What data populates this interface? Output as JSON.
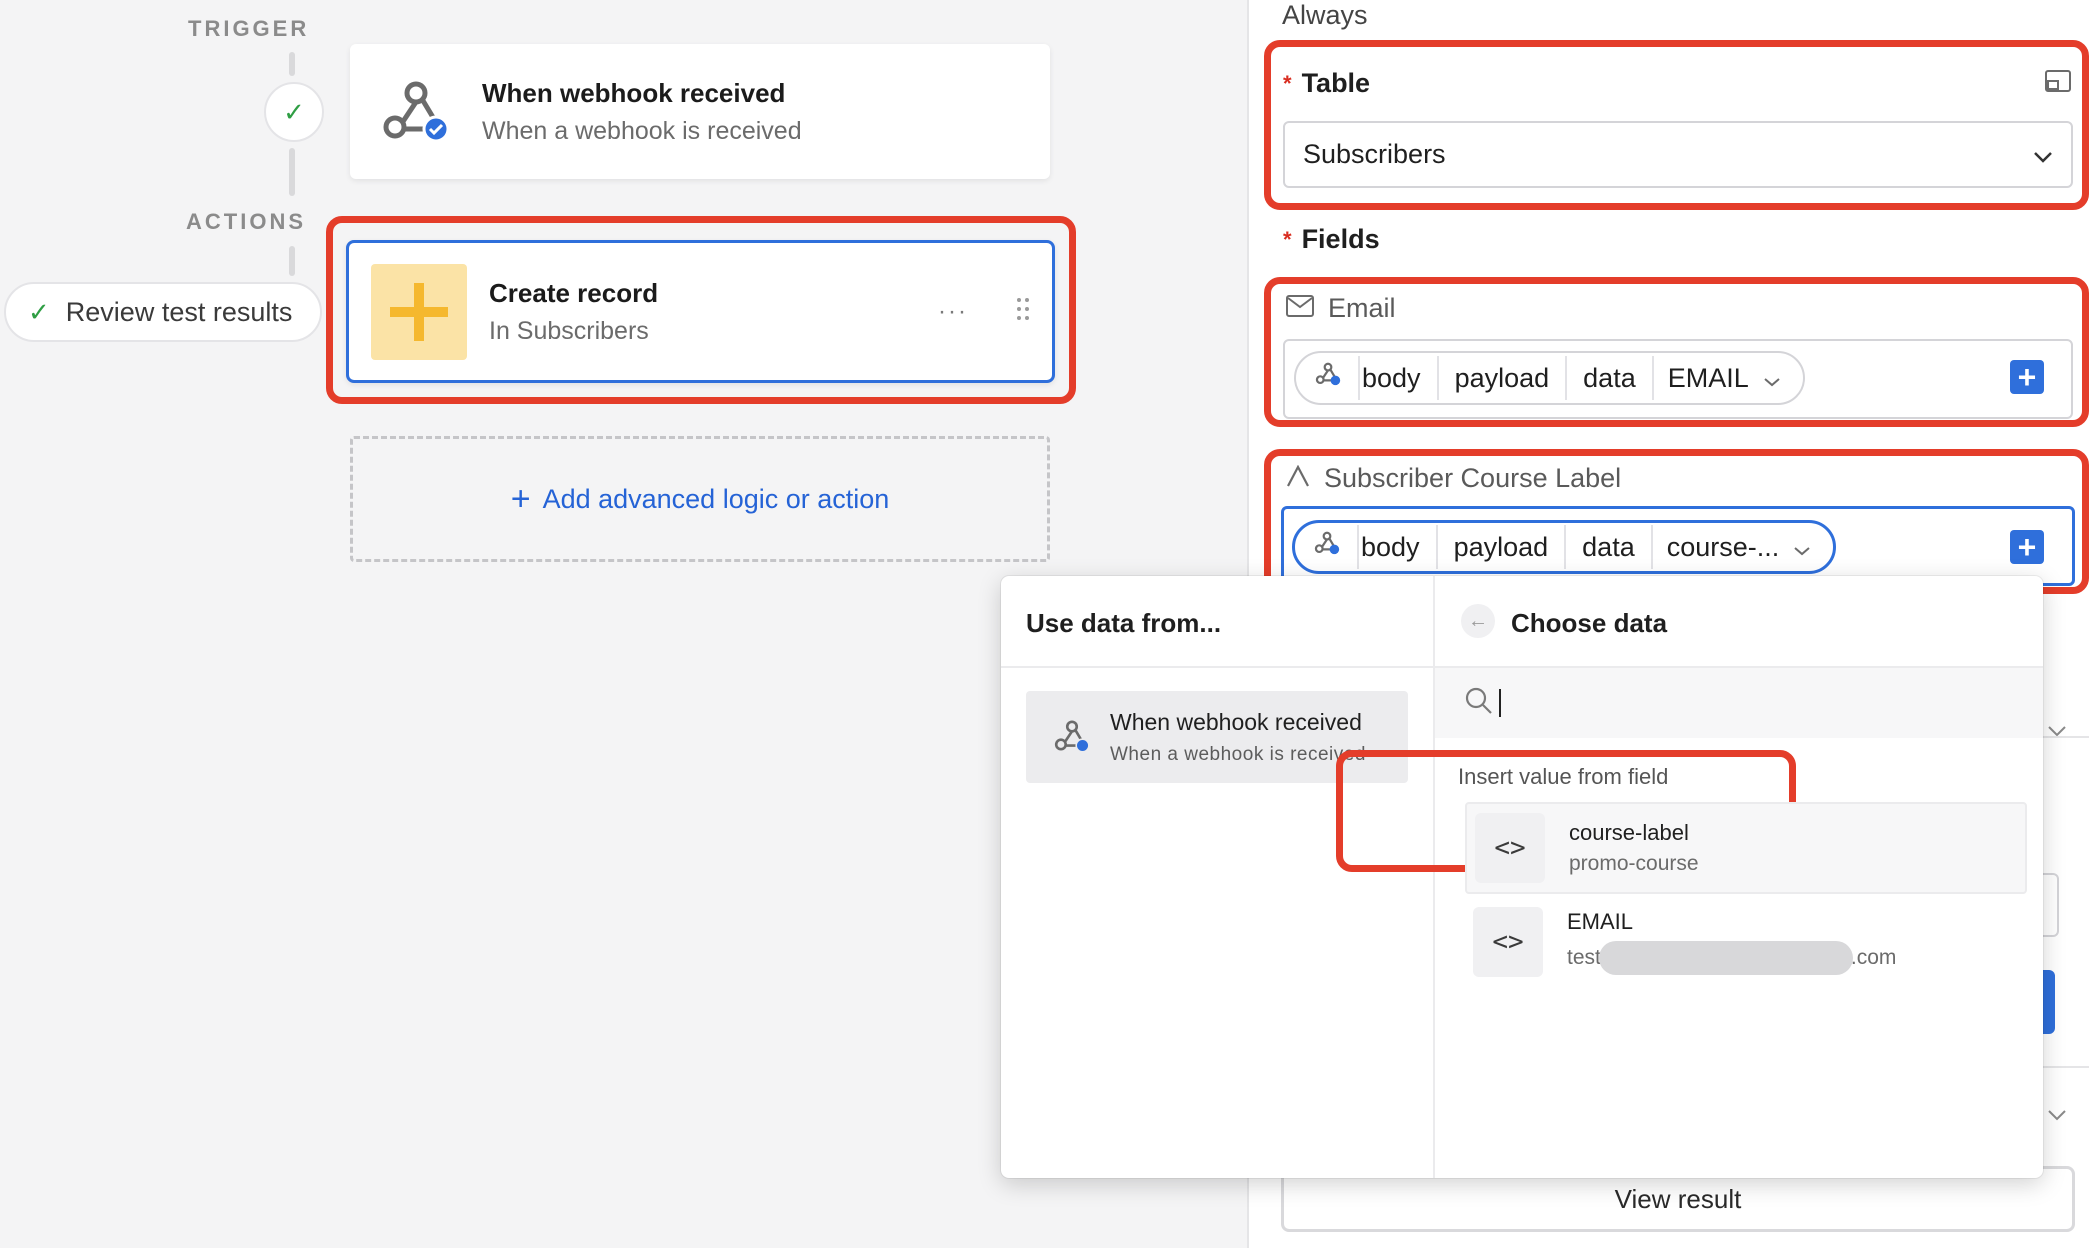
{
  "canvas": {
    "trigger_label": "TRIGGER",
    "actions_label": "ACTIONS",
    "review_label": "Review test results",
    "trigger_card": {
      "title": "When webhook received",
      "subtitle": "When a webhook is received"
    },
    "action_card": {
      "title": "Create record",
      "subtitle": "In Subscribers"
    },
    "add_action_label": "Add advanced logic or action"
  },
  "panel": {
    "condition_text": "Always",
    "table_label": "Table",
    "table_value": "Subscribers",
    "fields_label": "Fields",
    "email_field": {
      "label": "Email",
      "tokens": [
        "body",
        "payload",
        "data",
        "EMAIL"
      ]
    },
    "course_field": {
      "label": "Subscriber Course Label",
      "tokens": [
        "body",
        "payload",
        "data",
        "course-..."
      ]
    },
    "view_result_label": "View result"
  },
  "popup": {
    "left_heading": "Use data from...",
    "source": {
      "title": "When webhook received",
      "subtitle": "When a webhook is received"
    },
    "right_heading": "Choose data",
    "search_placeholder": "",
    "insert_label": "Insert value from field",
    "items": [
      {
        "title": "course-label",
        "value": "promo-course"
      },
      {
        "title": "EMAIL",
        "value_prefix": "test",
        "value_suffix": ".com"
      }
    ]
  },
  "colors": {
    "accent_blue": "#2f6fdb",
    "highlight_red": "#e43d2a",
    "plus_yellow": "#f5b82e",
    "success_green": "#2f9e44"
  }
}
